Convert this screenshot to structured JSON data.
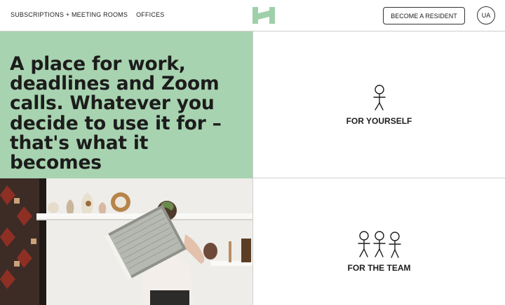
{
  "header": {
    "nav": [
      "SUBSCRIPTIONS + MEETING ROOMS",
      "OFFICES"
    ],
    "cta_label": "BECOME A RESIDENT",
    "lang_label": "UA",
    "brand_color": "#9fd0aa"
  },
  "hero": {
    "title": "A place for work, deadlines and Zoom calls. Whatever you decide to use it for – that's what it becomes",
    "background": "#a8d3b0"
  },
  "cards": {
    "self": {
      "label": "FOR YOURSELF",
      "icon": "single-person-icon"
    },
    "team": {
      "label": "FOR THE TEAM",
      "icon": "team-people-icon"
    }
  },
  "photo": {
    "subject": "person-holding-book-photo"
  }
}
